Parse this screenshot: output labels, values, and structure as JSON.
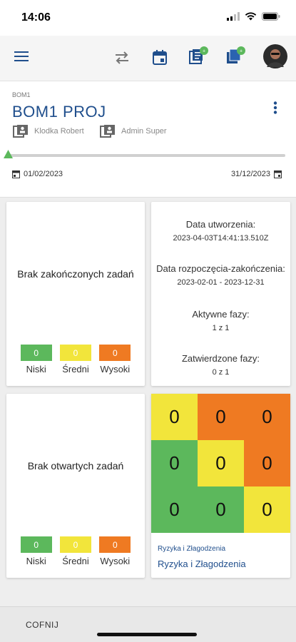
{
  "status_bar": {
    "time": "14:06"
  },
  "project": {
    "code": "BOM1",
    "title": "BOM1 PROJ",
    "people": [
      "Klodka Robert",
      "Admin Super"
    ],
    "start_date": "01/02/2023",
    "end_date": "31/12/2023",
    "progress": 0
  },
  "completed_tasks": {
    "message": "Brak zakończonych zadań",
    "legend": [
      {
        "count": "0",
        "label": "Niski",
        "color": "#5cb85c"
      },
      {
        "count": "0",
        "label": "Średni",
        "color": "#f2e53b"
      },
      {
        "count": "0",
        "label": "Wysoki",
        "color": "#ef7a22"
      }
    ]
  },
  "project_info": {
    "created_label": "Data utworzenia:",
    "created_value": "2023-04-03T14:41:13.510Z",
    "range_label": "Data rozpoczęcia-zakończenia:",
    "range_value": "2023-02-01 - 2023-12-31",
    "active_phases_label": "Aktywne fazy:",
    "active_phases_value": "1 z 1",
    "approved_phases_label": "Zatwierdzone fazy:",
    "approved_phases_value": "0 z 1"
  },
  "open_tasks": {
    "message": "Brak otwartych zadań",
    "legend": [
      {
        "count": "0",
        "label": "Niski",
        "color": "#5cb85c"
      },
      {
        "count": "0",
        "label": "Średni",
        "color": "#f2e53b"
      },
      {
        "count": "0",
        "label": "Wysoki",
        "color": "#ef7a22"
      }
    ]
  },
  "risks": {
    "matrix": [
      [
        {
          "value": "0",
          "color": "#f2e53b"
        },
        {
          "value": "0",
          "color": "#ef7a22"
        },
        {
          "value": "0",
          "color": "#ef7a22"
        }
      ],
      [
        {
          "value": "0",
          "color": "#5cb85c"
        },
        {
          "value": "0",
          "color": "#f2e53b"
        },
        {
          "value": "0",
          "color": "#ef7a22"
        }
      ],
      [
        {
          "value": "0",
          "color": "#5cb85c"
        },
        {
          "value": "0",
          "color": "#5cb85c"
        },
        {
          "value": "0",
          "color": "#f2e53b"
        }
      ]
    ],
    "caption_small": "Ryzyka i Złagodzenia",
    "caption": "Ryzyka i Złagodzenia"
  },
  "bottom_bar": {
    "back_label": "COFNIJ"
  },
  "colors": {
    "primary": "#1f4e8c",
    "badge": "#5cb85c",
    "marker": "#5cb85c"
  }
}
